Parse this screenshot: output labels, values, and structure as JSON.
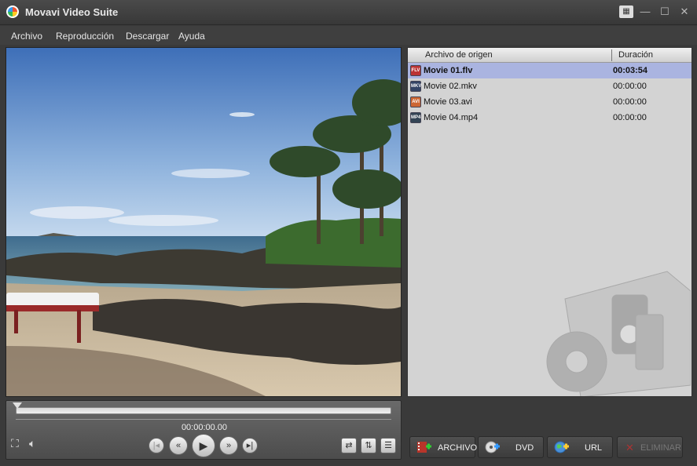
{
  "window": {
    "title": "Movavi Video Suite"
  },
  "menu": [
    "Archivo",
    "Reproducción",
    "Descargar",
    "Ayuda"
  ],
  "player": {
    "timecode": "00:00:00.00",
    "position": 0.0
  },
  "file_list": {
    "columns": {
      "source": "Archivo de origen",
      "duration": "Duración"
    },
    "rows": [
      {
        "name": "Movie 01.flv",
        "duration": "00:03:54",
        "type": "flv-icon",
        "selected": true
      },
      {
        "name": "Movie 02.mkv",
        "duration": "00:00:00",
        "type": "mkv-icon",
        "selected": false
      },
      {
        "name": "Movie 03.avi",
        "duration": "00:00:00",
        "type": "avi-icon",
        "selected": false
      },
      {
        "name": "Movie 04.mp4",
        "duration": "00:00:00",
        "type": "mp4-icon",
        "selected": false
      }
    ]
  },
  "actions": {
    "file": "ARCHIVO",
    "dvd": "DVD",
    "url": "URL",
    "delete": "ELIMINAR"
  },
  "colors": {
    "selected_row": "#aab4e0",
    "panel_bg": "#d3d3d3",
    "chrome": "#3a3a3a"
  }
}
